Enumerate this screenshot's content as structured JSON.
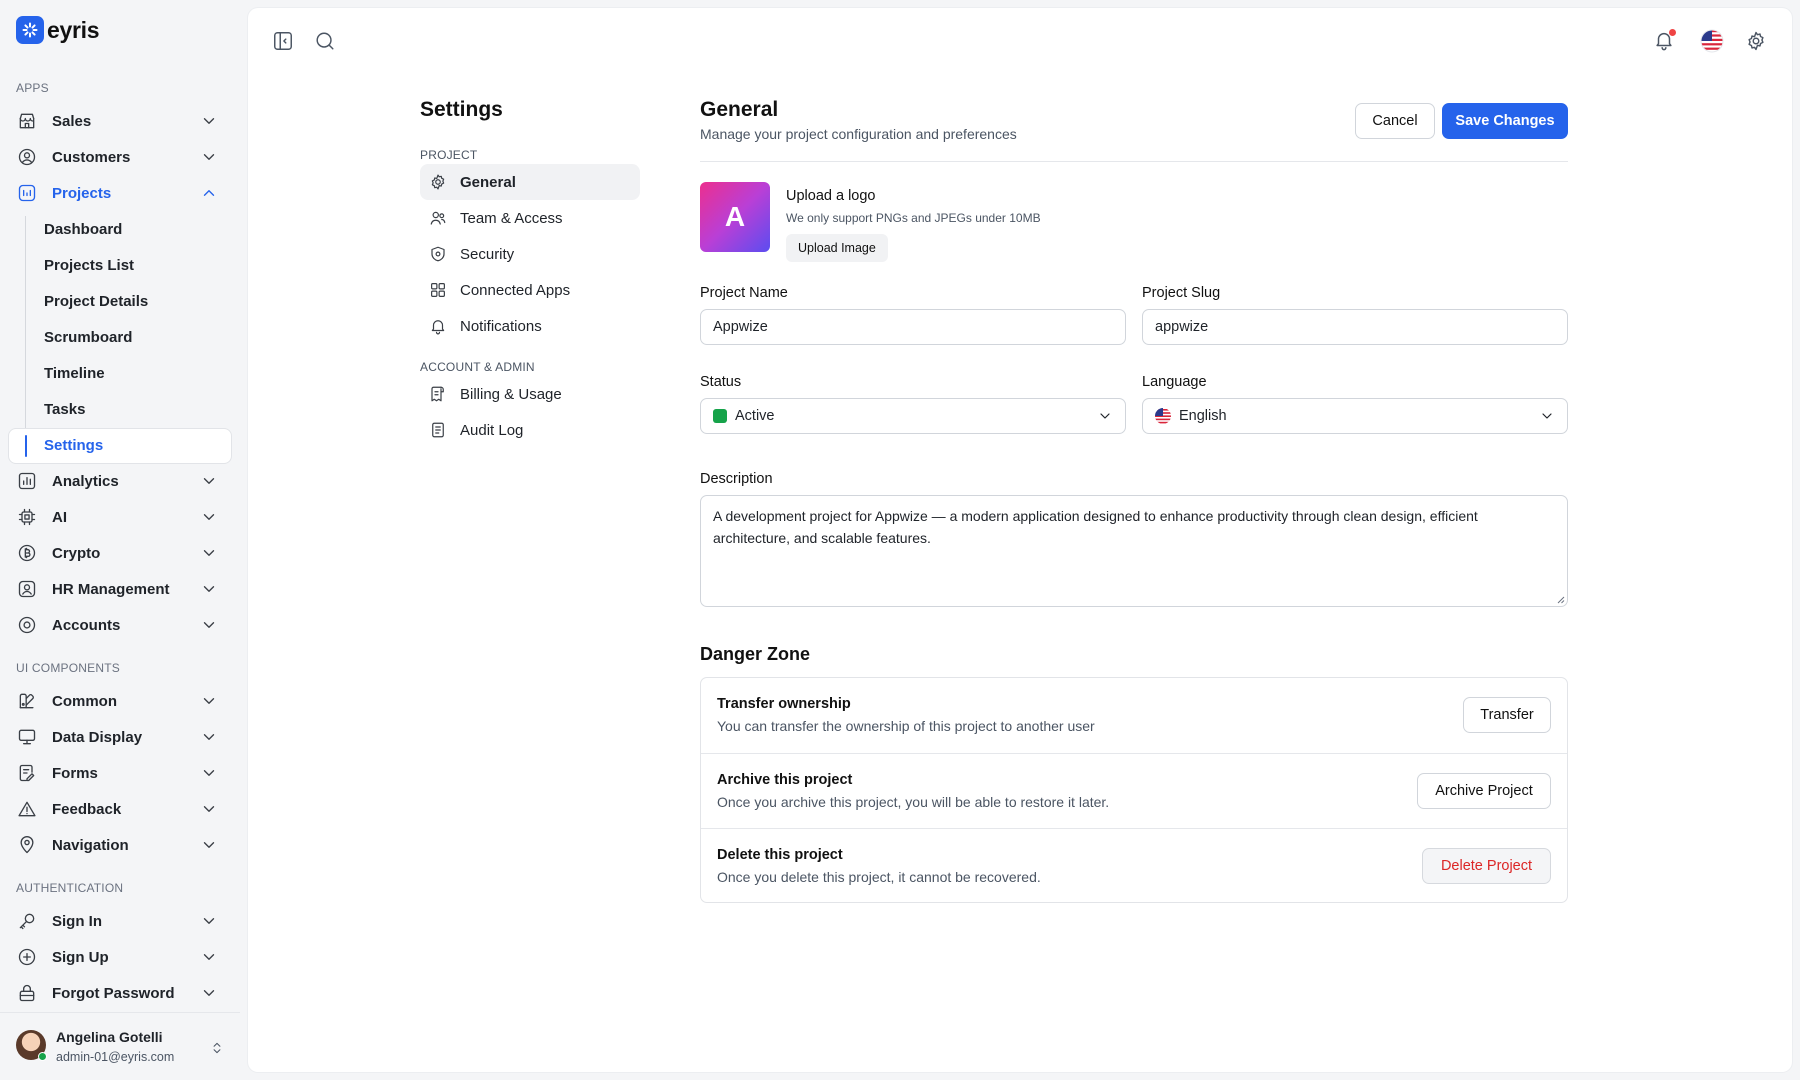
{
  "brand": {
    "name": "eyris"
  },
  "sidebar": {
    "sections": {
      "apps": "APPS",
      "ui": "UI COMPONENTS",
      "auth": "AUTHENTICATION"
    },
    "apps": [
      {
        "label": "Sales",
        "icon": "store-icon"
      },
      {
        "label": "Customers",
        "icon": "user-circle-icon"
      },
      {
        "label": "Projects",
        "icon": "chart-bars-icon"
      }
    ],
    "projects_sub": [
      "Dashboard",
      "Projects List",
      "Project Details",
      "Scrumboard",
      "Timeline",
      "Tasks",
      "Settings"
    ],
    "apps2": [
      {
        "label": "Analytics",
        "icon": "analytics-icon"
      },
      {
        "label": "AI",
        "icon": "chip-icon"
      },
      {
        "label": "Crypto",
        "icon": "bitcoin-icon"
      },
      {
        "label": "HR Management",
        "icon": "id-badge-icon"
      },
      {
        "label": "Accounts",
        "icon": "account-icon"
      }
    ],
    "ui": [
      {
        "label": "Common",
        "icon": "palette-icon"
      },
      {
        "label": "Data Display",
        "icon": "monitor-icon"
      },
      {
        "label": "Forms",
        "icon": "form-icon"
      },
      {
        "label": "Feedback",
        "icon": "warning-icon"
      },
      {
        "label": "Navigation",
        "icon": "map-pin-icon"
      }
    ],
    "auth": [
      {
        "label": "Sign In",
        "icon": "key-icon"
      },
      {
        "label": "Sign Up",
        "icon": "plus-circle-icon"
      },
      {
        "label": "Forgot Password",
        "icon": "lock-icon"
      }
    ],
    "user": {
      "name": "Angelina Gotelli",
      "email": "admin-01@eyris.com"
    }
  },
  "settings_nav": {
    "title": "Settings",
    "project_section": "PROJECT",
    "project_items": [
      "General",
      "Team & Access",
      "Security",
      "Connected Apps",
      "Notifications"
    ],
    "account_section": "ACCOUNT & ADMIN",
    "account_items": [
      "Billing & Usage",
      "Audit Log"
    ]
  },
  "general": {
    "title": "General",
    "subtitle": "Manage your project configuration and preferences",
    "cancel": "Cancel",
    "save": "Save Changes",
    "logo": {
      "letter": "A",
      "title": "Upload a logo",
      "hint": "We only support PNGs and JPEGs under 10MB",
      "button": "Upload Image"
    },
    "project_name": {
      "label": "Project Name",
      "value": "Appwize"
    },
    "project_slug": {
      "label": "Project Slug",
      "value": "appwize"
    },
    "status": {
      "label": "Status",
      "value": "Active",
      "color": "#16a34a"
    },
    "language": {
      "label": "Language",
      "value": "English"
    },
    "description": {
      "label": "Description",
      "value": "A development project for Appwize — a modern application designed to enhance productivity through clean design, efficient architecture, and scalable features."
    }
  },
  "danger_zone": {
    "title": "Danger Zone",
    "rows": [
      {
        "title": "Transfer ownership",
        "desc": "You can transfer the ownership of this project to another user",
        "button": "Transfer"
      },
      {
        "title": "Archive this project",
        "desc": "Once you archive this project, you will be able to restore it later.",
        "button": "Archive Project"
      },
      {
        "title": "Delete this project",
        "desc": "Once you delete this project, it cannot be recovered.",
        "button": "Delete Project"
      }
    ]
  },
  "colors": {
    "accent": "#2563eb",
    "danger": "#dc2626",
    "notification": "#ef4444"
  }
}
